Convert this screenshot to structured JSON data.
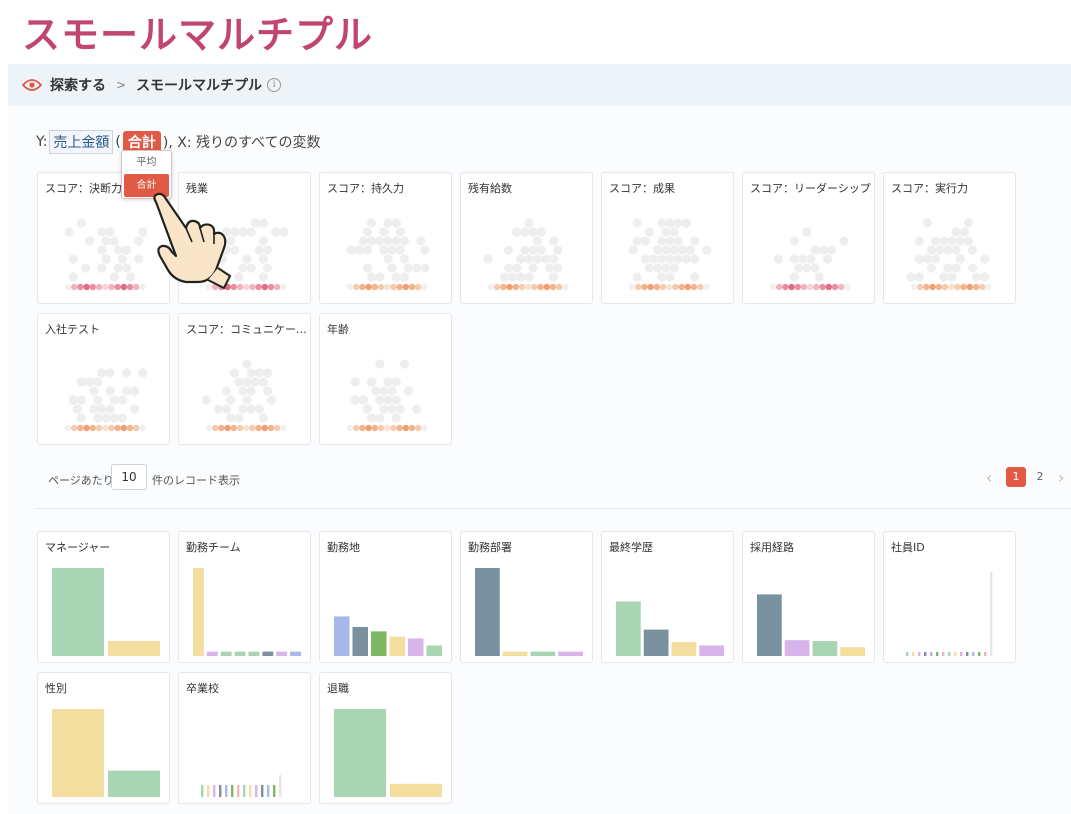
{
  "page_title": "スモールマルチプル",
  "breadcrumb": {
    "root": "探索する",
    "separator": ">",
    "current": "スモールマルチプル",
    "info_icon": "info-icon"
  },
  "yline": {
    "prefix": "Y:",
    "variable": "売上金額",
    "open_paren": "(",
    "aggregation": "合計",
    "suffix": "), X: 残りのすべての変数"
  },
  "aggregation_menu": {
    "options": [
      "平均",
      "合計"
    ],
    "selected": "合計"
  },
  "scatter_panels": [
    {
      "title": "スコア：決断力",
      "palette": "red"
    },
    {
      "title": "残業",
      "palette": "red"
    },
    {
      "title": "スコア：持久力",
      "palette": "orange"
    },
    {
      "title": "残有給数",
      "palette": "orange"
    },
    {
      "title": "スコア：成果",
      "palette": "orange"
    },
    {
      "title": "スコア：リーダーシップ",
      "palette": "red"
    },
    {
      "title": "スコア：実行力",
      "palette": "orange"
    },
    {
      "title": "入社テスト",
      "palette": "orange"
    },
    {
      "title": "スコア：コミュニケーション",
      "palette": "orange"
    },
    {
      "title": "年齢",
      "palette": "orange"
    }
  ],
  "pagination": {
    "per_page_label": "ページあたり",
    "per_page": "10",
    "records_label": "件のレコード表示",
    "pages": [
      "1",
      "2"
    ],
    "current_page": "1"
  },
  "bar_panels": [
    {
      "title": "マネージャー",
      "bars": [
        {
          "v": 1.0,
          "c": "#a8d5b4"
        },
        {
          "v": 0.17,
          "c": "#f3dea0"
        }
      ]
    },
    {
      "title": "勤務チーム",
      "bars": [
        {
          "v": 1.0,
          "c": "#f3dea0"
        },
        {
          "v": 0.05,
          "c": "#d8b4ea"
        },
        {
          "v": 0.05,
          "c": "#a8d5b4"
        },
        {
          "v": 0.05,
          "c": "#a8d5b4"
        },
        {
          "v": 0.05,
          "c": "#a8d5b4"
        },
        {
          "v": 0.05,
          "c": "#7a92a0"
        },
        {
          "v": 0.05,
          "c": "#d8b4ea"
        },
        {
          "v": 0.05,
          "c": "#a8b8e8"
        }
      ]
    },
    {
      "title": "勤務地",
      "bars": [
        {
          "v": 0.45,
          "c": "#a8b8e8"
        },
        {
          "v": 0.33,
          "c": "#7a92a0"
        },
        {
          "v": 0.28,
          "c": "#7fb862"
        },
        {
          "v": 0.22,
          "c": "#f3dea0"
        },
        {
          "v": 0.2,
          "c": "#d8b4ea"
        },
        {
          "v": 0.12,
          "c": "#a8d5b4"
        }
      ]
    },
    {
      "title": "勤務部署",
      "bars": [
        {
          "v": 1.0,
          "c": "#7a92a0"
        },
        {
          "v": 0.05,
          "c": "#f3dea0"
        },
        {
          "v": 0.05,
          "c": "#a8d5b4"
        },
        {
          "v": 0.05,
          "c": "#d8b4ea"
        }
      ]
    },
    {
      "title": "最終学歴",
      "bars": [
        {
          "v": 0.62,
          "c": "#a8d5b4"
        },
        {
          "v": 0.3,
          "c": "#7a92a0"
        },
        {
          "v": 0.16,
          "c": "#f3dea0"
        },
        {
          "v": 0.12,
          "c": "#d8b4ea"
        }
      ]
    },
    {
      "title": "採用経路",
      "bars": [
        {
          "v": 0.7,
          "c": "#7a92a0"
        },
        {
          "v": 0.18,
          "c": "#d8b4ea"
        },
        {
          "v": 0.17,
          "c": "#a8d5b4"
        },
        {
          "v": 0.1,
          "c": "#f3dea0"
        }
      ]
    },
    {
      "title": "社員ID",
      "type": "many"
    },
    {
      "title": "性別",
      "bars": [
        {
          "v": 1.0,
          "c": "#f3dea0"
        },
        {
          "v": 0.3,
          "c": "#a8d5b4"
        }
      ]
    },
    {
      "title": "卒業校",
      "type": "many2"
    },
    {
      "title": "退職",
      "bars": [
        {
          "v": 1.0,
          "c": "#a8d5b4"
        },
        {
          "v": 0.15,
          "c": "#f3dea0"
        }
      ]
    }
  ]
}
